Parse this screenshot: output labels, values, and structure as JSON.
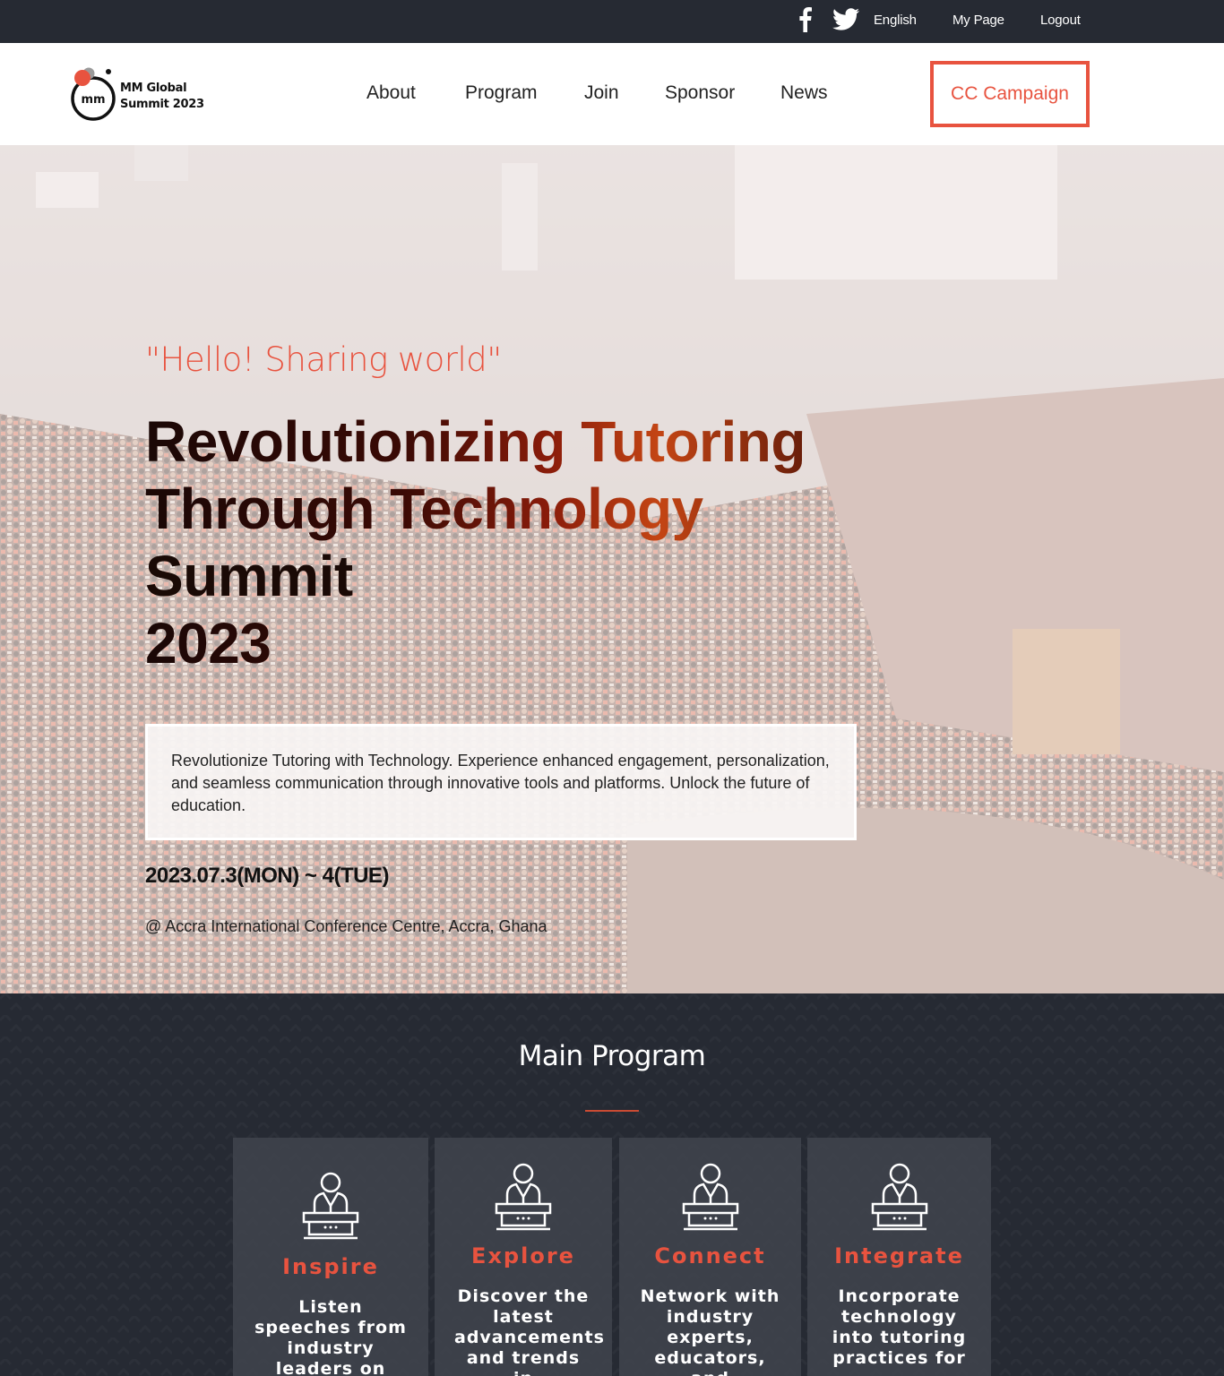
{
  "topbar": {
    "facebook_icon": "facebook-icon",
    "twitter_icon": "twitter-icon",
    "language": "English",
    "my_page": "My Page",
    "logout": "Logout"
  },
  "header": {
    "logo_mark": "mm",
    "logo_line1": "MM Global",
    "logo_line2": "Summit 2023",
    "nav": [
      "About",
      "Program",
      "Join",
      "Sponsor",
      "News"
    ],
    "cta": "CC Campaign",
    "accent_color": "#e8533f"
  },
  "hero": {
    "tagline": "\"Hello! Sharing world\"",
    "headline": [
      "Revolutionizing Tutoring",
      "Through Technology",
      "Summit",
      "2023"
    ],
    "description": "Revolutionize Tutoring with Technology. Experience enhanced engagement, personalization, and seamless communication through innovative tools and platforms. Unlock the future of education.",
    "date": "2023.07.3(MON) ~ 4(TUE)",
    "venue": "@ Accra International Conference Centre, Accra, Ghana"
  },
  "program": {
    "title": "Main Program",
    "cards": [
      {
        "title": "Inspire",
        "text": "Listen speeches from industry leaders on revolutionizing",
        "icon": "speaker-podium-icon"
      },
      {
        "title": "Explore",
        "text": "Discover the latest advancements and trends in",
        "icon": "speaker-podium-icon"
      },
      {
        "title": "Connect",
        "text": "Network with industry experts, educators, and",
        "icon": "speaker-podium-icon"
      },
      {
        "title": "Integrate",
        "text": "Incorporate technology into tutoring practices for",
        "icon": "speaker-podium-icon"
      }
    ]
  }
}
